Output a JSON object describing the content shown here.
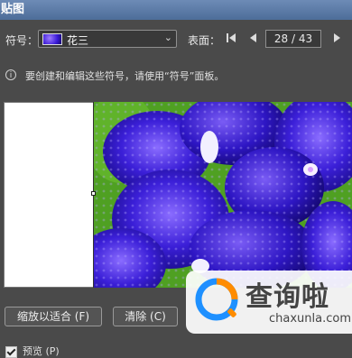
{
  "window": {
    "title": "贴图"
  },
  "symbol": {
    "label": "符号：",
    "selected": "花三",
    "swatch_icon": "flower-swatch-icon"
  },
  "surface": {
    "label": "表面：",
    "current_page": "28",
    "total_pages": "43",
    "page_text": "28 / 43",
    "first_icon": "first-page-icon",
    "prev_icon": "prev-page-icon",
    "next_icon": "next-page-icon"
  },
  "info": {
    "icon": "info-icon",
    "text": "要创建和编辑这些符号，请使用“符号”面板。"
  },
  "buttons": {
    "fit": "缩放以适合 (F)",
    "clear": "清除 (C)"
  },
  "preview": {
    "label": "预览 (P)",
    "checked": true
  },
  "watermark": {
    "cn": "查询啦",
    "en": "chaxunla.com"
  },
  "colors": {
    "background": "#4a4a4a",
    "titlebar": "#5b7aa8",
    "orchid": "#3a1ad6",
    "leaf": "#4fa022"
  }
}
